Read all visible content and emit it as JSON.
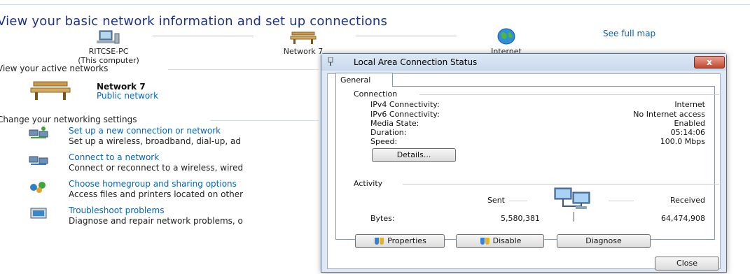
{
  "page": {
    "heading": "View your basic network information and set up connections",
    "see_full_map": "See full map"
  },
  "network_map": {
    "computer_name": "RITCSE-PC",
    "computer_sub": "(This computer)",
    "network_name": "Network  7",
    "internet": "Internet"
  },
  "active_networks": {
    "title": "View your active networks",
    "network_name": "Network  7",
    "network_type": "Public network"
  },
  "settings": {
    "title": "Change your networking settings",
    "tasks": [
      {
        "link": "Set up a new connection or network",
        "desc": "Set up a wireless, broadband, dial-up, ad",
        "icon": "new-connection-icon"
      },
      {
        "link": "Connect to a network",
        "desc": "Connect or reconnect to a wireless, wired",
        "icon": "connect-network-icon"
      },
      {
        "link": "Choose homegroup and sharing options",
        "desc": "Access files and printers located on other",
        "icon": "homegroup-icon"
      },
      {
        "link": "Troubleshoot problems",
        "desc": "Diagnose and repair network problems, o",
        "icon": "troubleshoot-icon"
      }
    ]
  },
  "dialog": {
    "title": "Local Area Connection Status",
    "close_glyph": "x",
    "tab": "General",
    "connection": {
      "label": "Connection",
      "rows": [
        {
          "label": "IPv4 Connectivity:",
          "value": "Internet"
        },
        {
          "label": "IPv6 Connectivity:",
          "value": "No Internet access"
        },
        {
          "label": "Media State:",
          "value": "Enabled"
        },
        {
          "label": "Duration:",
          "value": "05:14:06"
        },
        {
          "label": "Speed:",
          "value": "100.0 Mbps"
        }
      ],
      "details_button": "Details..."
    },
    "activity": {
      "label": "Activity",
      "sent_label": "Sent",
      "received_label": "Received",
      "bytes_label": "Bytes:",
      "bytes_sent": "5,580,381",
      "bytes_received": "64,474,908"
    },
    "buttons": {
      "properties": "Properties",
      "disable": "Disable",
      "diagnose": "Diagnose",
      "close": "Close"
    }
  },
  "colors": {
    "link": "#0a63b8",
    "heading": "#1e3287",
    "close_button": "#c3462c",
    "dialog_frame": "#dfe9f5"
  }
}
